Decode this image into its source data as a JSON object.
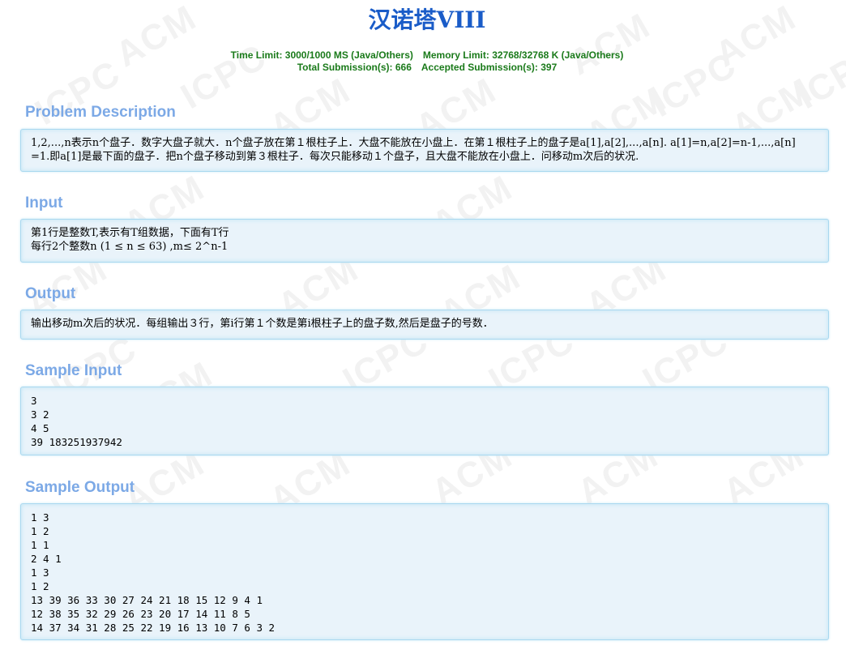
{
  "problem": {
    "title": "汉诺塔VIII",
    "limits": {
      "time": "Time Limit: 3000/1000 MS (Java/Others)",
      "memory": "Memory Limit: 32768/32768 K (Java/Others)",
      "total": "Total Submission(s): 666",
      "accepted": "Accepted Submission(s): 397"
    }
  },
  "sections": {
    "description": {
      "title": "Problem Description",
      "lines": [
        "1,2,...,n表示n个盘子．数字大盘子就大．n个盘子放在第１根柱子上．大盘不能放在小盘上．在第１根柱子上的盘子是a[1],a[2],...,a[n]. a[1]=n,a[2]=n-1,...,a[n]",
        "=1.即a[1]是最下面的盘子．把n个盘子移动到第３根柱子．每次只能移动１个盘子，且大盘不能放在小盘上．问移动m次后的状况."
      ]
    },
    "input": {
      "title": "Input",
      "lines": [
        "第1行是整数T,表示有T组数据，下面有T行",
        "每行2个整数n (1 ≤ n ≤ 63) ,m≤ 2^n-1"
      ]
    },
    "output": {
      "title": "Output",
      "lines": [
        "输出移动m次后的状况．每组输出３行，第i行第１个数是第i根柱子上的盘子数,然后是盘子的号数．"
      ]
    },
    "sample_input": {
      "title": "Sample Input",
      "lines": [
        "3",
        "3 2",
        "4 5",
        "39 183251937942"
      ]
    },
    "sample_output": {
      "title": "Sample Output",
      "lines": [
        "1 3",
        "1 2",
        "1 1",
        "2 4 1",
        "1 3",
        "1 2",
        "13 39 36 33 30 27 24 21 18 15 12 9 4 1",
        "12 38 35 32 29 26 23 20 17 14 11 8 5",
        "14 37 34 31 28 25 22 19 16 13 10 7 6 3 2"
      ]
    }
  },
  "watermark": "ACM ICPC",
  "colors": {
    "title": "#1a5cc8",
    "limits": "#1a7a1a",
    "section_title": "#7ca9e6",
    "panel_bg": "#e9f3fa",
    "panel_border": "#a9d8ef"
  }
}
